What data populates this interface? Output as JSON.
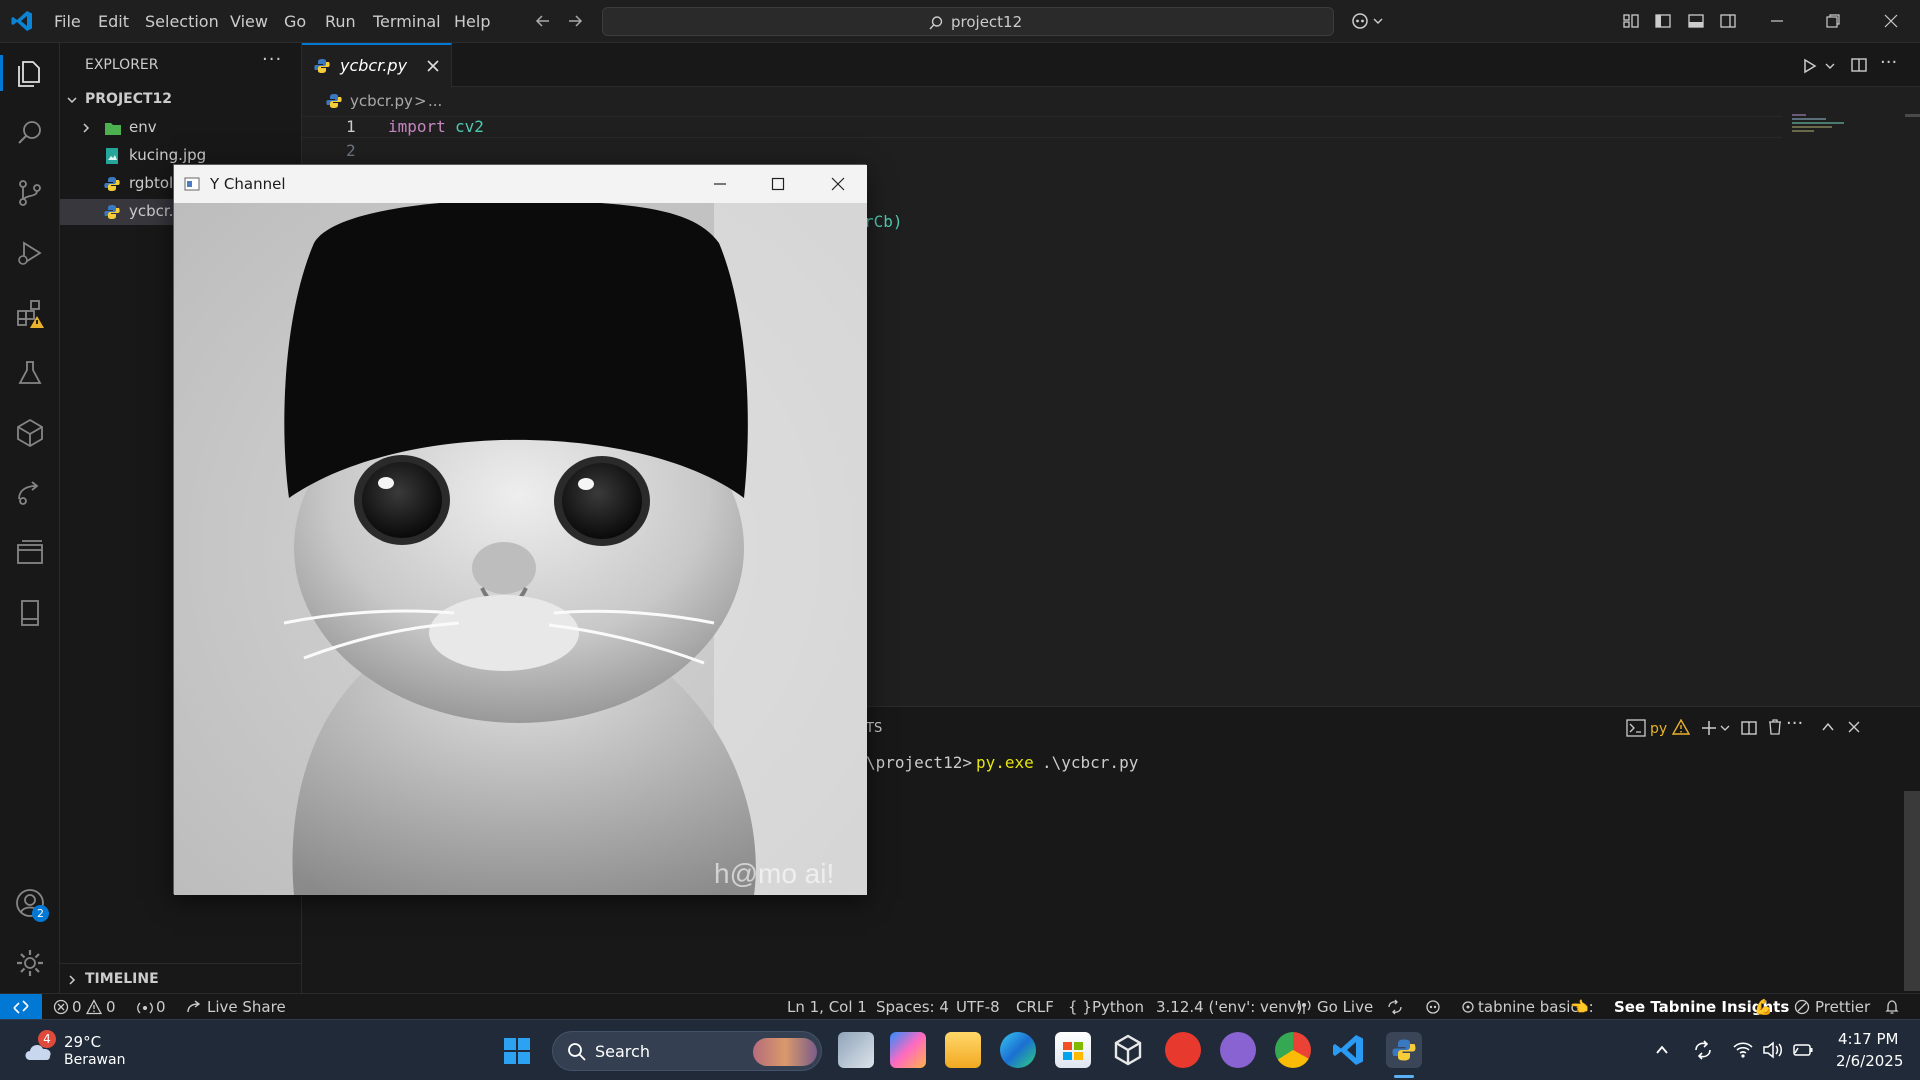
{
  "menu": [
    "File",
    "Edit",
    "Selection",
    "View",
    "Go",
    "Run",
    "Terminal",
    "Help"
  ],
  "search": {
    "text": "project12"
  },
  "explorer": {
    "title": "EXPLORER",
    "project": "PROJECT12",
    "items": [
      {
        "label": "env",
        "kind": "folder"
      },
      {
        "label": "kucing.jpg",
        "kind": "image"
      },
      {
        "label": "rgbtol",
        "kind": "python"
      },
      {
        "label": "ycbcr.",
        "kind": "python"
      }
    ],
    "timeline": "TIMELINE"
  },
  "editor": {
    "tab_label": "ycbcr.py",
    "breadcrumb_file": "ycbcr.py",
    "breadcrumb_sep": ">",
    "breadcrumb_rest": "...",
    "line1_num": "1",
    "line2_num": "2",
    "line1_kw": "import",
    "line1_mod": "cv2",
    "partial_code": "rCb)"
  },
  "panel": {
    "tab_fragment": "TS",
    "terminal_label": "py",
    "prompt": "\\project12>",
    "command": "py.exe",
    "arg": ".\\ycbcr.py"
  },
  "ywindow": {
    "title": "Y Channel",
    "watermark": "h@mo ai!"
  },
  "statusbar": {
    "errors": "0",
    "warnings": "0",
    "ports": "0",
    "liveshare": "Live Share",
    "position": "Ln 1, Col 1",
    "spaces": "Spaces: 4",
    "encoding": "UTF-8",
    "eol": "CRLF",
    "language": "Python",
    "interpreter": "3.12.4 ('env': venv)",
    "golive": "Go Live",
    "tabnine": "tabnine basic",
    "tabnine_insights": "See Tabnine Insights",
    "prettier": "Prettier"
  },
  "accounts_badge": "2",
  "taskbar": {
    "weather_badge": "4",
    "temp": "29°C",
    "condition": "Berawan",
    "search": "Search",
    "time": "4:17 PM",
    "date": "2/6/2025"
  }
}
